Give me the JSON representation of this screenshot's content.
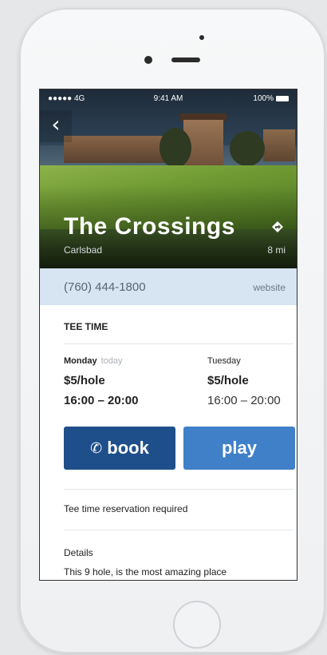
{
  "status_bar": {
    "signal": "●●●●● 4G",
    "time": "9:41 AM",
    "battery": "100%"
  },
  "course": {
    "name": "The Crossings",
    "city": "Carlsbad",
    "distance": "8 mi"
  },
  "contact": {
    "phone": "(760) 444-1800",
    "website_label": "website"
  },
  "tee_time": {
    "label": "TEE TIME",
    "days": [
      {
        "day": "Monday",
        "note": "today",
        "price": "$5/hole",
        "hours": "16:00 – 20:00"
      },
      {
        "day": "Tuesday",
        "note": "",
        "price": "$5/hole",
        "hours": "16:00 – 20:00"
      }
    ]
  },
  "actions": {
    "book_label": "book",
    "play_label": "play"
  },
  "notice": "Tee time reservation required",
  "details": {
    "label": "Details",
    "text": "This 9 hole, is the most amazing place"
  },
  "colors": {
    "book": "#1f4f8a",
    "play": "#3f80c9",
    "contact_bar": "#d7e4f2"
  },
  "icons": {
    "back": "chevron-left-icon",
    "directions": "directions-diamond-icon",
    "phone": "phone-icon"
  }
}
